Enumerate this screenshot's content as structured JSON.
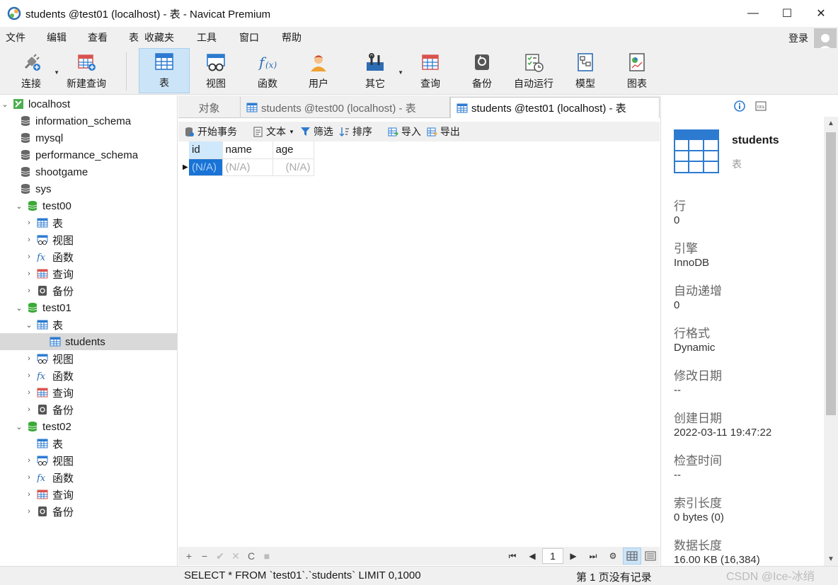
{
  "window": {
    "title": "students @test01 (localhost) - 表 - Navicat Premium",
    "min": "—",
    "max": "☐",
    "close": "✕"
  },
  "menu": [
    "文件",
    "编辑",
    "查看",
    "表",
    "收藏夹",
    "工具",
    "窗口",
    "帮助"
  ],
  "login": "登录",
  "toolbar": {
    "connect": "连接",
    "new_query": "新建查询",
    "table": "表",
    "view": "视图",
    "function": "函数",
    "user": "用户",
    "other": "其它",
    "query": "查询",
    "backup": "备份",
    "automation": "自动运行",
    "model": "模型",
    "chart": "图表"
  },
  "tree": {
    "connection": "localhost",
    "databases": [
      "information_schema",
      "mysql",
      "performance_schema",
      "shootgame",
      "sys"
    ],
    "test00": {
      "name": "test00",
      "items": [
        "表",
        "视图",
        "函数",
        "查询",
        "备份"
      ]
    },
    "test01": {
      "name": "test01",
      "table_group": "表",
      "selected_table": "students",
      "items": [
        "视图",
        "函数",
        "查询",
        "备份"
      ]
    },
    "test02": {
      "name": "test02",
      "items": [
        "表",
        "视图",
        "函数",
        "查询",
        "备份"
      ]
    }
  },
  "tabs": {
    "objects": "对象",
    "tab1": "students @test00 (localhost) - 表",
    "tab2": "students @test01 (localhost) - 表"
  },
  "subtoolbar": {
    "begin_transaction": "开始事务",
    "text": "文本",
    "filter": "筛选",
    "sort": "排序",
    "import": "导入",
    "export": "导出"
  },
  "grid": {
    "columns": [
      "id",
      "name",
      "age"
    ],
    "rows": [
      [
        "(N/A)",
        "(N/A)",
        "(N/A)"
      ]
    ]
  },
  "bottombar": {
    "add": "+",
    "remove": "−",
    "apply": "✔",
    "discard": "✕",
    "refresh": "C",
    "stop": "■",
    "page_number": "1"
  },
  "status": {
    "sql": "SELECT * FROM `test01`.`students` LIMIT 0,1000",
    "page_info": "第 1 页没有记录",
    "watermark": "CSDN @Ice-冰绡"
  },
  "info_panel": {
    "name": "students",
    "type": "表",
    "properties": [
      {
        "label": "行",
        "value": "0"
      },
      {
        "label": "引擎",
        "value": "InnoDB"
      },
      {
        "label": "自动递增",
        "value": "0"
      },
      {
        "label": "行格式",
        "value": "Dynamic"
      },
      {
        "label": "修改日期",
        "value": "--"
      },
      {
        "label": "创建日期",
        "value": "2022-03-11 19:47:22"
      },
      {
        "label": "检查时间",
        "value": "--"
      },
      {
        "label": "索引长度",
        "value": "0 bytes (0)"
      },
      {
        "label": "数据长度",
        "value": "16.00 KB (16,384)"
      }
    ]
  }
}
